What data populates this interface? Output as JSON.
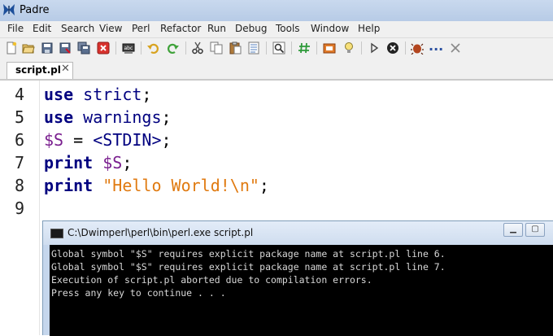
{
  "window": {
    "title": "Padre"
  },
  "menu": {
    "items": [
      "File",
      "Edit",
      "Search",
      "View",
      "Perl",
      "Refactor",
      "Run",
      "Debug",
      "Tools",
      "Window",
      "Help"
    ]
  },
  "toolbar": {
    "buttons": [
      "new-file",
      "open-file",
      "save",
      "save-as",
      "save-all",
      "close",
      "spell-check",
      "undo",
      "redo",
      "cut",
      "copy",
      "paste",
      "select-all",
      "find",
      "comment",
      "open-folder",
      "tip",
      "run",
      "stop",
      "debug"
    ],
    "more_label": "..."
  },
  "tabs": [
    {
      "label": "script.pl",
      "close_glyph": "✕"
    }
  ],
  "editor": {
    "lines": [
      {
        "number": "4",
        "tokens": [
          {
            "t": "use",
            "c": "kw"
          },
          {
            "t": " ",
            "c": "punct"
          },
          {
            "t": "strict",
            "c": "ident"
          },
          {
            "t": ";",
            "c": "punct"
          }
        ]
      },
      {
        "number": "5",
        "tokens": [
          {
            "t": "use",
            "c": "kw"
          },
          {
            "t": " ",
            "c": "punct"
          },
          {
            "t": "warnings",
            "c": "ident"
          },
          {
            "t": ";",
            "c": "punct"
          }
        ]
      },
      {
        "number": "6",
        "tokens": [
          {
            "t": "$S",
            "c": "var"
          },
          {
            "t": " = ",
            "c": "punct"
          },
          {
            "t": "<STDIN>",
            "c": "ident"
          },
          {
            "t": ";",
            "c": "punct"
          }
        ]
      },
      {
        "number": "7",
        "tokens": [
          {
            "t": "print",
            "c": "kw"
          },
          {
            "t": " ",
            "c": "punct"
          },
          {
            "t": "$S",
            "c": "var"
          },
          {
            "t": ";",
            "c": "punct"
          }
        ]
      },
      {
        "number": "8",
        "tokens": [
          {
            "t": "print",
            "c": "kw"
          },
          {
            "t": " ",
            "c": "punct"
          },
          {
            "t": "\"Hello World!\\n\"",
            "c": "str"
          },
          {
            "t": ";",
            "c": "punct"
          }
        ]
      },
      {
        "number": "9",
        "tokens": []
      }
    ]
  },
  "console": {
    "title": "C:\\Dwimperl\\perl\\bin\\perl.exe  script.pl",
    "lines": [
      "Global symbol \"$S\" requires explicit package name at script.pl line 6.",
      "Global symbol \"$S\" requires explicit package name at script.pl line 7.",
      "Execution of script.pl aborted due to compilation errors.",
      "Press any key to continue . . ."
    ]
  },
  "colors": {
    "keyword": "#00007f",
    "variable": "#7a1f8f",
    "string": "#e07a10",
    "console_bg": "#000000",
    "console_fg": "#d8d8d8"
  }
}
